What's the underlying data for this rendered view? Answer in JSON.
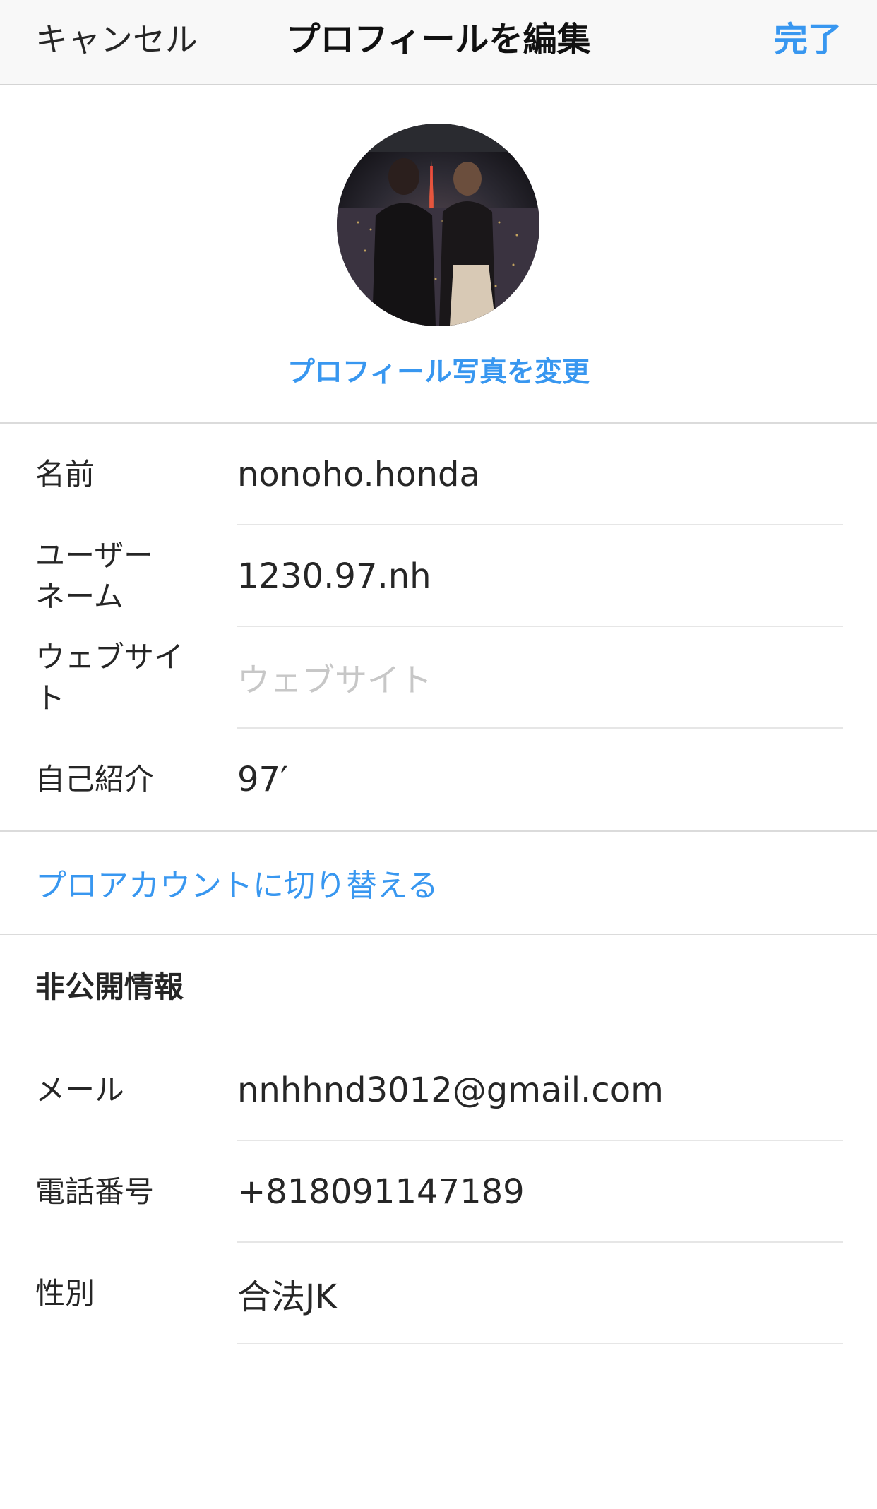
{
  "navbar": {
    "cancel_label": "キャンセル",
    "title": "プロフィールを編集",
    "done_label": "完了"
  },
  "profile": {
    "change_photo_label": "プロフィール写真を変更"
  },
  "fields": [
    {
      "label": "名前",
      "value": "nonoho.honda"
    },
    {
      "label": "ユーザーネーム",
      "label_line1": "ユーザー",
      "label_line2": "ネーム",
      "value": "1230.97.nh"
    },
    {
      "label": "ウェブサイト",
      "value": "",
      "placeholder": "ウェブサイト"
    },
    {
      "label": "自己紹介",
      "value": "97′"
    }
  ],
  "pro_account_label": "プロアカウントに切り替える",
  "private_info": {
    "header": "非公開情報",
    "fields": [
      {
        "label": "メール",
        "value": "nnhhnd3012@gmail.com"
      },
      {
        "label": "電話番号",
        "value": "+818091147189"
      },
      {
        "label": "性別",
        "value": "合法JK"
      }
    ]
  },
  "colors": {
    "accent": "#3897f0",
    "text": "#262626",
    "placeholder": "#c7c7c7",
    "navbar_bg": "#f8f8f8",
    "divider": "#dbdbdb"
  },
  "icons": {
    "avatar": "profile-photo"
  }
}
